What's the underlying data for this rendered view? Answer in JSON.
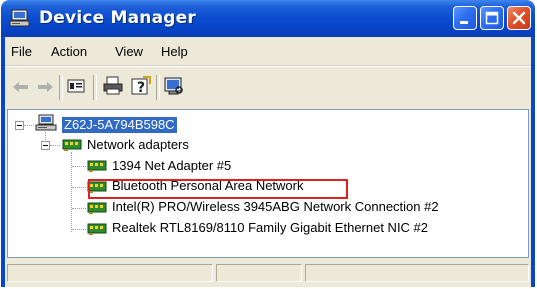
{
  "window": {
    "title": "Device Manager",
    "icon": "device-manager-icon",
    "controls": [
      "minimize-icon",
      "maximize-icon",
      "close-icon"
    ]
  },
  "menu": {
    "file": "File",
    "action": "Action",
    "view": "View",
    "help": "Help"
  },
  "toolbar": {
    "buttons": [
      "back-arrow-icon",
      "forward-arrow-icon",
      "properties-icon",
      "print-icon",
      "help-icon",
      "hardware-scan-icon"
    ]
  },
  "tree": {
    "root": {
      "label": "Z62J-5A794B598C",
      "selected": true,
      "icon": "computer-icon"
    },
    "category": {
      "label": "Network adapters",
      "icon": "network-adapter-icon",
      "expanded": true
    },
    "devices": [
      {
        "label": "1394 Net Adapter #5"
      },
      {
        "label": "Bluetooth Personal Area Network",
        "highlighted": true
      },
      {
        "label": "Intel(R) PRO/Wireless 3945ABG Network Connection #2"
      },
      {
        "label": "Realtek RTL8169/8110 Family Gigabit Ethernet NIC #2"
      }
    ]
  },
  "colors": {
    "title_bar": "#0a4cd0",
    "selection": "#316ac5",
    "highlight_box": "#e02020",
    "chrome": "#ece9d8"
  }
}
